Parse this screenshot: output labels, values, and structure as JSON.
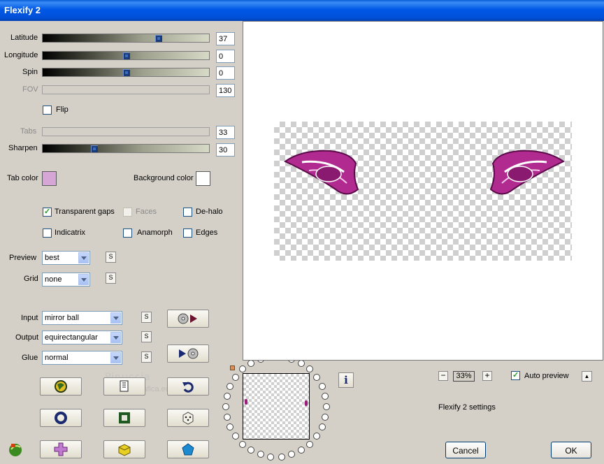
{
  "window": {
    "title": "Flexify 2"
  },
  "sliders": [
    {
      "label": "Latitude",
      "value": "37",
      "fraction": 0.7,
      "enabled": true
    },
    {
      "label": "Longitude",
      "value": "0",
      "fraction": 0.5,
      "enabled": true
    },
    {
      "label": "Spin",
      "value": "0",
      "fraction": 0.5,
      "enabled": true
    },
    {
      "label": "FOV",
      "value": "130",
      "fraction": null,
      "enabled": false
    },
    {
      "label": "Tabs",
      "value": "33",
      "fraction": null,
      "enabled": false
    },
    {
      "label": "Sharpen",
      "value": "30",
      "fraction": 0.31,
      "enabled": true
    }
  ],
  "flip": {
    "label": "Flip",
    "checked": false
  },
  "colors": {
    "tab_color_label": "Tab color",
    "tab_color": "#d6a6d6",
    "background_color_label": "Background color",
    "background_color": "#ffffff"
  },
  "options": {
    "transparent_gaps": {
      "label": "Transparent gaps",
      "checked": true
    },
    "faces": {
      "label": "Faces",
      "checked": false,
      "enabled": false
    },
    "de_halo": {
      "label": "De-halo",
      "checked": false
    },
    "indicatrix": {
      "label": "Indicatrix",
      "checked": false
    },
    "anamorph": {
      "label": "Anamorph",
      "checked": false
    },
    "edges": {
      "label": "Edges",
      "checked": false
    }
  },
  "preview_select": {
    "label": "Preview",
    "value": "best"
  },
  "grid_select": {
    "label": "Grid",
    "value": "none"
  },
  "input_select": {
    "label": "Input",
    "value": "mirror ball"
  },
  "output_select": {
    "label": "Output",
    "value": "equirectangular"
  },
  "glue_select": {
    "label": "Glue",
    "value": "normal"
  },
  "s_label": "S",
  "watermark": {
    "line1": "Pinuccia",
    "line2": "www.taidigrafica.eu"
  },
  "zoom": {
    "minus": "−",
    "value": "33%",
    "plus": "+"
  },
  "auto_preview": {
    "label": "Auto preview",
    "checked": true
  },
  "collapse_label": "▲",
  "settings_text": "Flexify 2 settings",
  "buttons": {
    "cancel": "Cancel",
    "ok": "OK"
  },
  "accent": "#9c1e7c",
  "icons": [
    "globe-icon",
    "document-icon",
    "undo-icon",
    "ring-icon",
    "square-icon",
    "dice-icon",
    "leaf-icon",
    "cross-icon",
    "cube-icon",
    "pentagon-icon",
    "disc-play-icon",
    "play-disc-icon",
    "info-icon"
  ]
}
